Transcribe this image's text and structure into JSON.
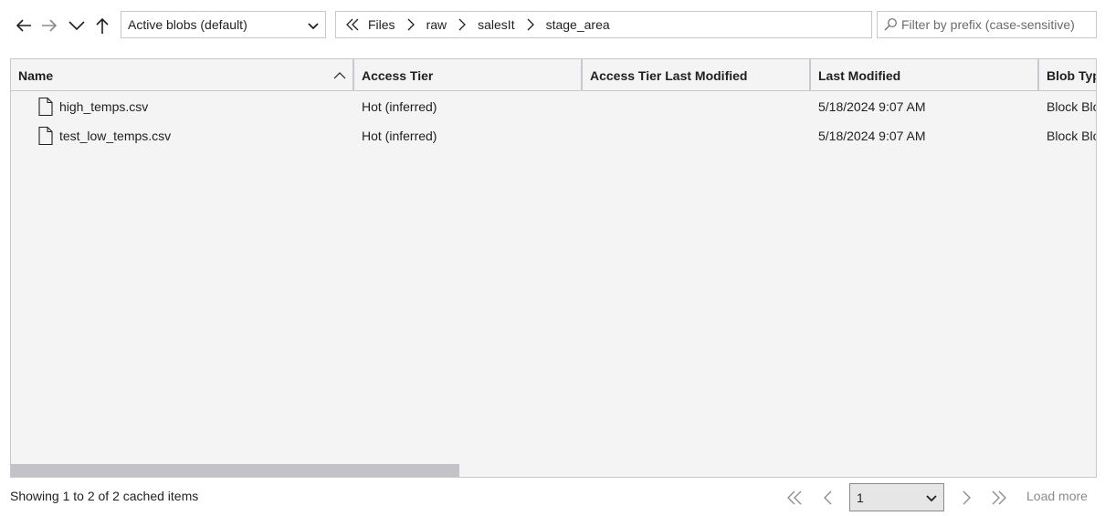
{
  "toolbar": {
    "view_select": {
      "value": "Active blobs (default)"
    },
    "breadcrumb": [
      "Files",
      "raw",
      "salesIt",
      "stage_area"
    ],
    "filter": {
      "placeholder": "Filter by prefix (case-sensitive)"
    }
  },
  "grid": {
    "columns": [
      "Name",
      "Access Tier",
      "Access Tier Last Modified",
      "Last Modified",
      "Blob Type"
    ],
    "rows": [
      {
        "name": "high_temps.csv",
        "access_tier": "Hot (inferred)",
        "access_tier_last_modified": "",
        "last_modified": "5/18/2024 9:07 AM",
        "blob_type": "Block Blob"
      },
      {
        "name": "test_low_temps.csv",
        "access_tier": "Hot (inferred)",
        "access_tier_last_modified": "",
        "last_modified": "5/18/2024 9:07 AM",
        "blob_type": "Block Blob"
      }
    ]
  },
  "footer": {
    "status": "Showing 1 to 2 of 2 cached items",
    "page": "1",
    "load_more": "Load more"
  },
  "colors": {
    "grid_bg": "#f4f4f4",
    "border": "#c8c8c8",
    "scroll_thumb": "#c2c2c8",
    "disabled_text": "#8a8a8a"
  }
}
